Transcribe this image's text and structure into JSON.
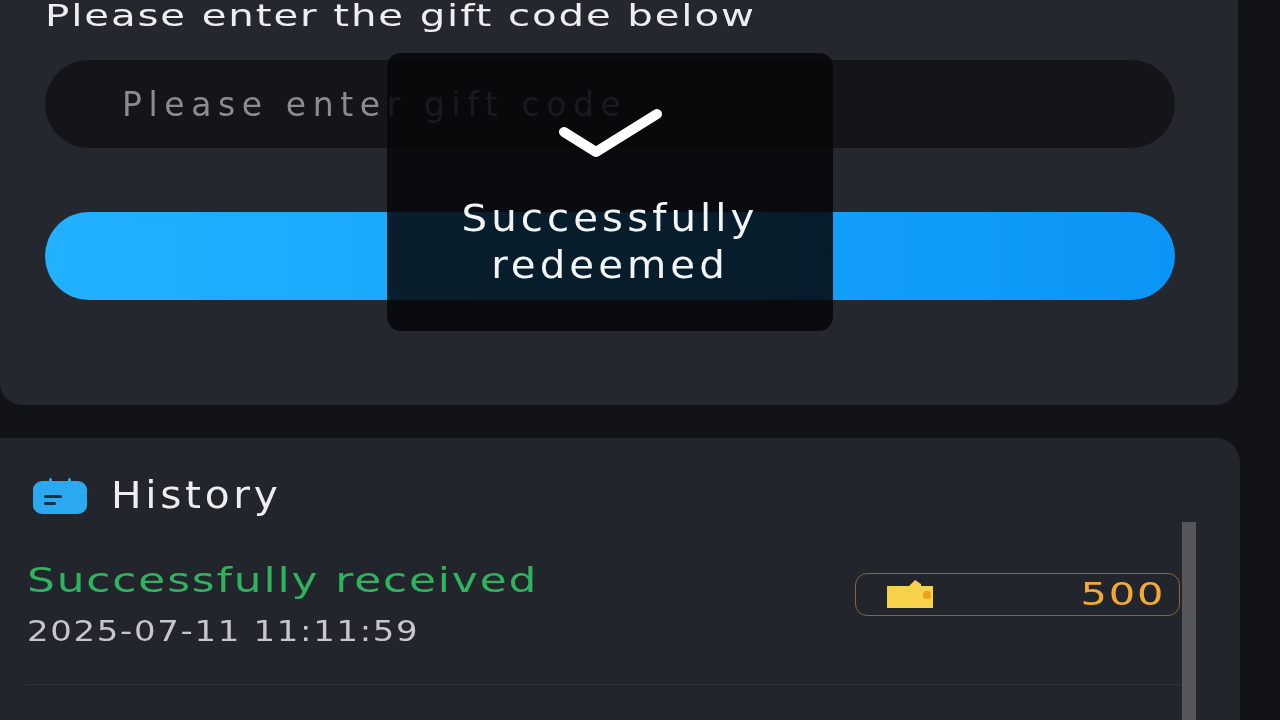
{
  "gift_code": {
    "instruction": "Please enter the gift code below",
    "input": {
      "placeholder": "Please enter gift code"
    }
  },
  "toast": {
    "message": "Successfully redeemed"
  },
  "history": {
    "title": "History",
    "records": [
      {
        "kind": "success",
        "status": "Successfully received",
        "time": "2025-07-11 11:11:59",
        "amount": "500"
      }
    ]
  }
}
